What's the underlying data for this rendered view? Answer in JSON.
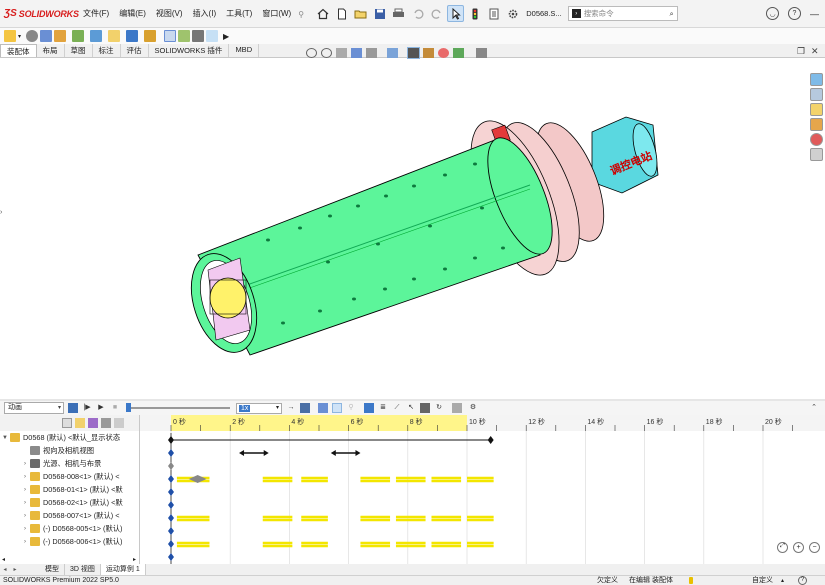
{
  "app": {
    "logo_text": "SOLIDWORKS",
    "doc_title": "D0568.S...",
    "search_placeholder": "搜索命令",
    "help_label": "?"
  },
  "menu": [
    "文件(F)",
    "编辑(E)",
    "视图(V)",
    "插入(I)",
    "工具(T)",
    "窗口(W)"
  ],
  "tabs": [
    {
      "label": "装配体",
      "active": true
    },
    {
      "label": "布局",
      "active": false
    },
    {
      "label": "草图",
      "active": false
    },
    {
      "label": "标注",
      "active": false
    },
    {
      "label": "评估",
      "active": false
    },
    {
      "label": "SOLIDWORKS 插件",
      "active": false
    },
    {
      "label": "MBD",
      "active": false
    }
  ],
  "model": {
    "label_text": "调控电站",
    "colors": {
      "tube": "#5cf59a",
      "flange": "#f3c8c8",
      "cylinder": "#5ad8e0",
      "core": "#fff26a",
      "accent": "#e33a3a"
    }
  },
  "motion": {
    "study_type": "动画",
    "speed": "1x",
    "time_labels": [
      "0 秒",
      "2 秒",
      "4 秒",
      "6 秒",
      "8 秒",
      "10 秒",
      "12 秒",
      "14 秒",
      "16 秒",
      "18 秒",
      "20 秒"
    ],
    "tree": [
      {
        "label": "D0568 (默认) <默认_显示状态",
        "expander": "▼",
        "icon": "assembly"
      },
      {
        "label": "视向及相机视图",
        "expander": "",
        "icon": "camera"
      },
      {
        "label": "光源、相机与布景",
        "expander": "›",
        "icon": "light"
      },
      {
        "label": "D0568-008<1> (默认) <",
        "expander": "›",
        "icon": "part"
      },
      {
        "label": "D0568-01<1> (默认) <默",
        "expander": "›",
        "icon": "part"
      },
      {
        "label": "D0568-02<1> (默认) <默",
        "expander": "›",
        "icon": "part"
      },
      {
        "label": "D0568-007<1> (默认) <",
        "expander": "›",
        "icon": "part"
      },
      {
        "label": "(-) D0568-005<1> (默认)",
        "expander": "›",
        "icon": "part"
      },
      {
        "label": "(-) D0568-006<1> (默认)",
        "expander": "›",
        "icon": "part"
      }
    ]
  },
  "bottom_tabs": [
    {
      "label": "模型",
      "active": false
    },
    {
      "label": "3D 视图",
      "active": false
    },
    {
      "label": "运动算例 1",
      "active": true
    }
  ],
  "status": {
    "app_version": "SOLIDWORKS Premium 2022 SP5.0",
    "undefined": "欠定义",
    "editing": "在编辑 装配体",
    "custom": "自定义"
  }
}
